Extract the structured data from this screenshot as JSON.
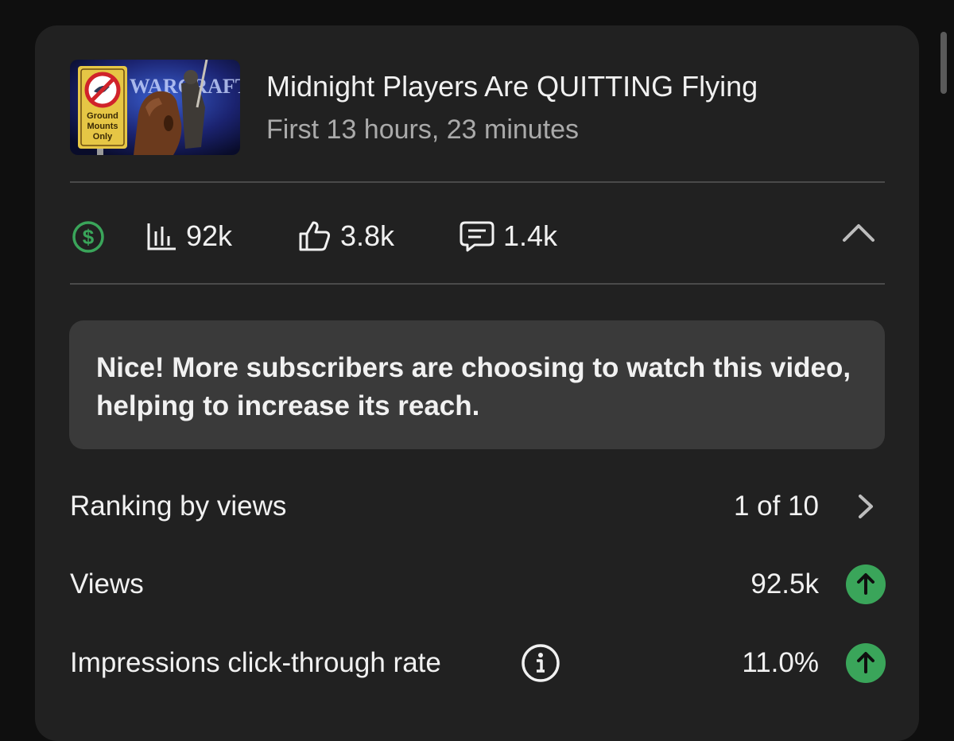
{
  "video": {
    "title": "Midnight Players Are QUITTING Flying",
    "subtitle": "First 13 hours, 23 minutes",
    "thumbnail": {
      "sign_text_line1": "Ground",
      "sign_text_line2": "Mounts",
      "sign_text_line3": "Only",
      "icon": "video-thumbnail"
    }
  },
  "stats": {
    "monetization_icon": "dollar-circle-icon",
    "views": "92k",
    "likes": "3.8k",
    "comments": "1.4k"
  },
  "info_message": "Nice! More subscribers are choosing to watch this video, helping to increase its reach.",
  "metrics": [
    {
      "label": "Ranking by views",
      "value": "1 of 10",
      "trail_icon": "chevron-right-icon"
    },
    {
      "label": "Views",
      "value": "92.5k",
      "trail_icon": "arrow-up-icon"
    },
    {
      "label": "Impressions click-through rate",
      "value": "11.0%",
      "trail_icon": "arrow-up-icon",
      "info_icon": "info-icon"
    }
  ],
  "colors": {
    "background": "#0f0f0f",
    "card": "#212121",
    "info_box": "#3a3a3a",
    "positive_green": "#3aa55a",
    "secondary_text": "#aaaaaa"
  }
}
